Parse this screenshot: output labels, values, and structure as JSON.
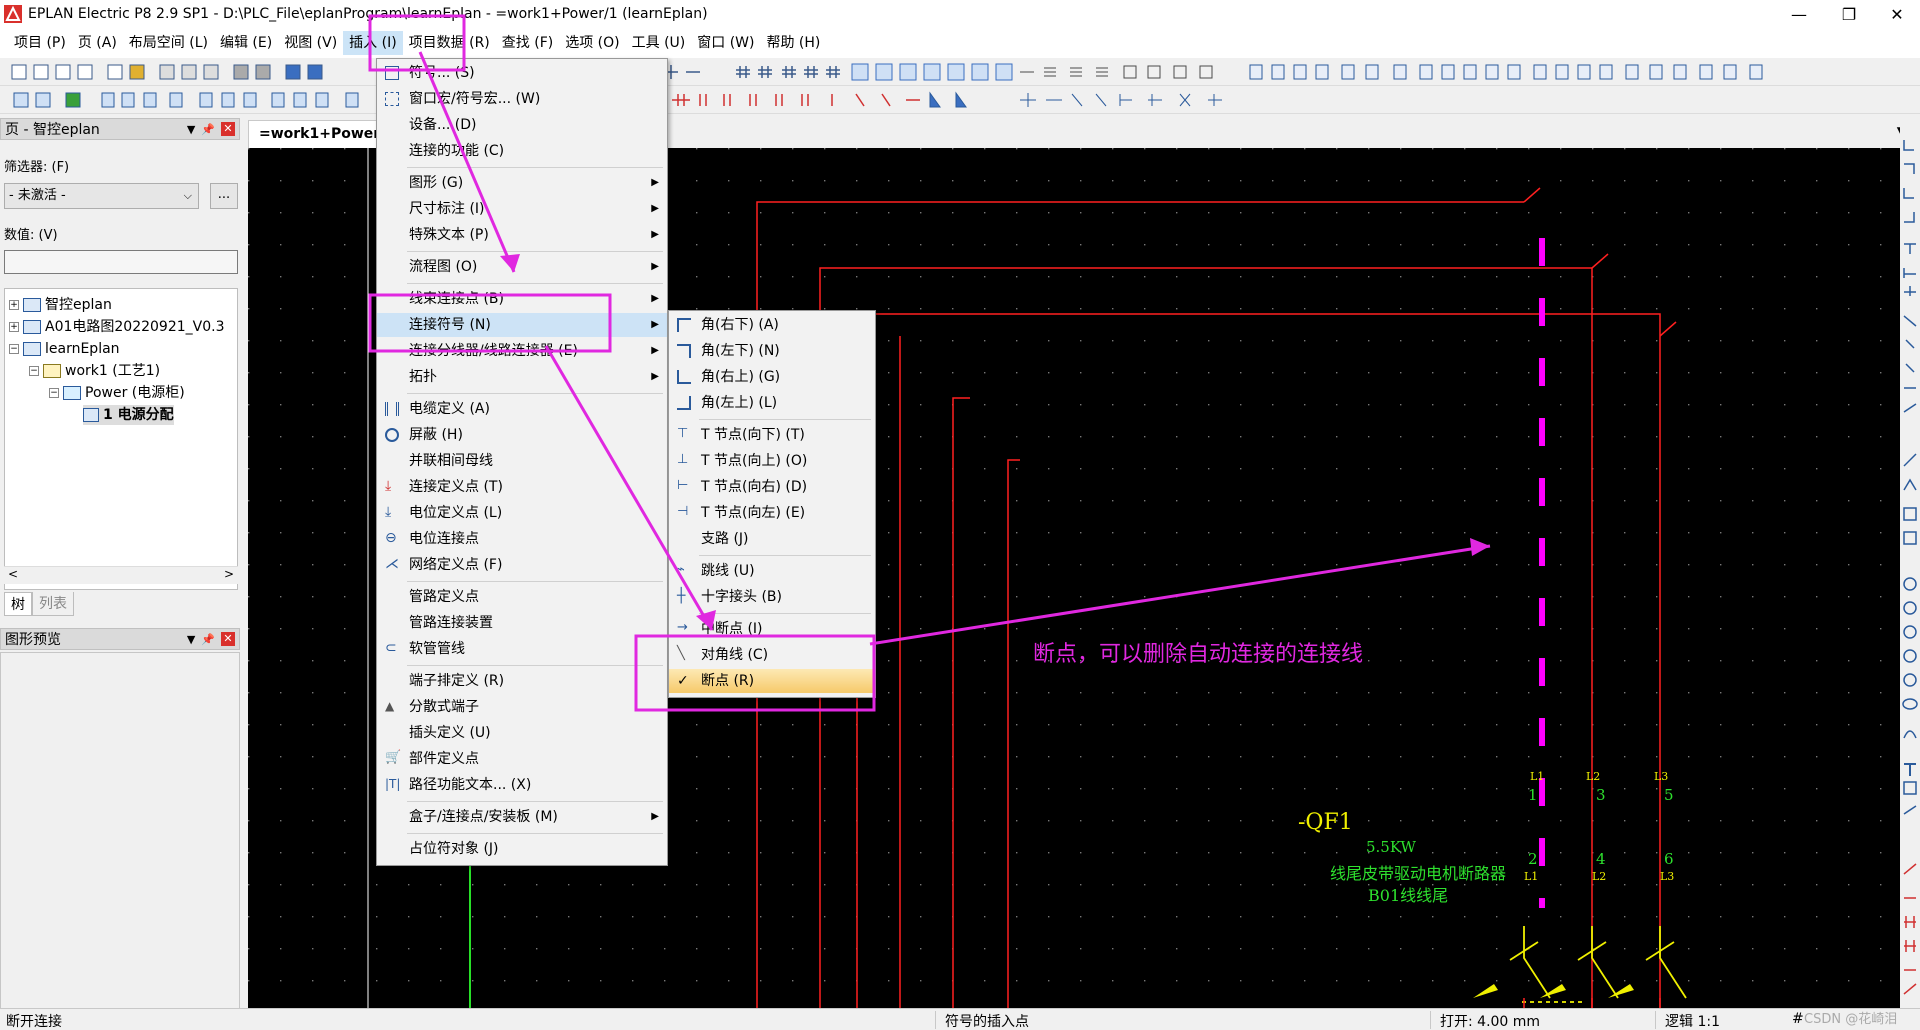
{
  "window": {
    "title": "EPLAN Electric P8 2.9 SP1 - D:\\PLC_File\\eplanProgram\\learnEplan - =work1+Power/1 (learnEplan)",
    "minimize": "—",
    "maximize": "❐",
    "close": "✕"
  },
  "menubar": [
    "项目 (P)",
    "页 (A)",
    "布局空间 (L)",
    "编辑 (E)",
    "视图 (V)",
    "插入 (I)",
    "项目数据 (R)",
    "查找 (F)",
    "选项 (O)",
    "工具 (U)",
    "窗口 (W)",
    "帮助 (H)"
  ],
  "page_panel": {
    "title": "页 - 智控eplan",
    "filter_label": "筛选器: (F)",
    "filter_value": "- 未激活 -",
    "filter_more": "...",
    "value_label": "数值: (V)",
    "tree": [
      "智控eplan",
      "A01电路图20220921_V0.3",
      "learnEplan",
      "work1 (工艺1)",
      "Power (电源柜)",
      "1 电源分配"
    ],
    "tabs": [
      "树",
      "列表"
    ]
  },
  "preview_panel": {
    "title": "图形预览"
  },
  "doc_tab": "=work1+Power/1",
  "insert_menu": [
    "符号... (S)",
    "窗口宏/符号宏... (W)",
    "设备... (D)",
    "连接的功能 (C)",
    "图形 (G)",
    "尺寸标注 (I)",
    "特殊文本 (P)",
    "流程图 (O)",
    "线束连接点 (B)",
    "连接符号 (N)",
    "连接分线器/线路连接器 (E)",
    "拓扑",
    "电缆定义 (A)",
    "屏蔽 (H)",
    "并联相间母线",
    "连接定义点 (T)",
    "电位定义点 (L)",
    "电位连接点",
    "网络定义点 (F)",
    "管路定义点",
    "管路连接装置",
    "软管管线",
    "端子排定义 (R)",
    "分散式端子",
    "插头定义 (U)",
    "部件定义点",
    "路径功能文本... (X)",
    "盒子/连接点/安装板 (M)",
    "占位符对象 (J)"
  ],
  "connection_submenu": [
    "角(右下) (A)",
    "角(左下) (N)",
    "角(右上) (G)",
    "角(左上) (L)",
    "T 节点(向下) (T)",
    "T 节点(向上) (O)",
    "T 节点(向右) (D)",
    "T 节点(向左) (E)",
    "支路 (J)",
    "跳线 (U)",
    "十字接头 (B)",
    "中断点 (I)",
    "对角线 (C)",
    "断点 (R)"
  ],
  "checked_item": "✓",
  "annotation": "断点，可以删除自动连接的连接线",
  "schematic": {
    "device_tag": "-QF1",
    "power": "5.5KW",
    "description": "线尾皮带驱动电机断路器",
    "location": "B01线线尾",
    "top_pins": [
      "1",
      "3",
      "5"
    ],
    "top_phase": [
      "L1",
      "L2",
      "L3"
    ],
    "bottom_pins": [
      "2",
      "4",
      "6"
    ],
    "bottom_phase": [
      "L1",
      "L2",
      "L3"
    ]
  },
  "statusbar": {
    "left": "断开连接",
    "middle": "符号的插入点",
    "open": "打开: 4.00 mm",
    "logic": "逻辑 1:1",
    "hash": "#"
  },
  "watermark": "CSDN @花崎泪",
  "colors": {
    "annotation": "#e028e0",
    "wire_red": "#ff2020",
    "label_green": "#2ee02e",
    "symbol_yellow": "#f0f000"
  }
}
